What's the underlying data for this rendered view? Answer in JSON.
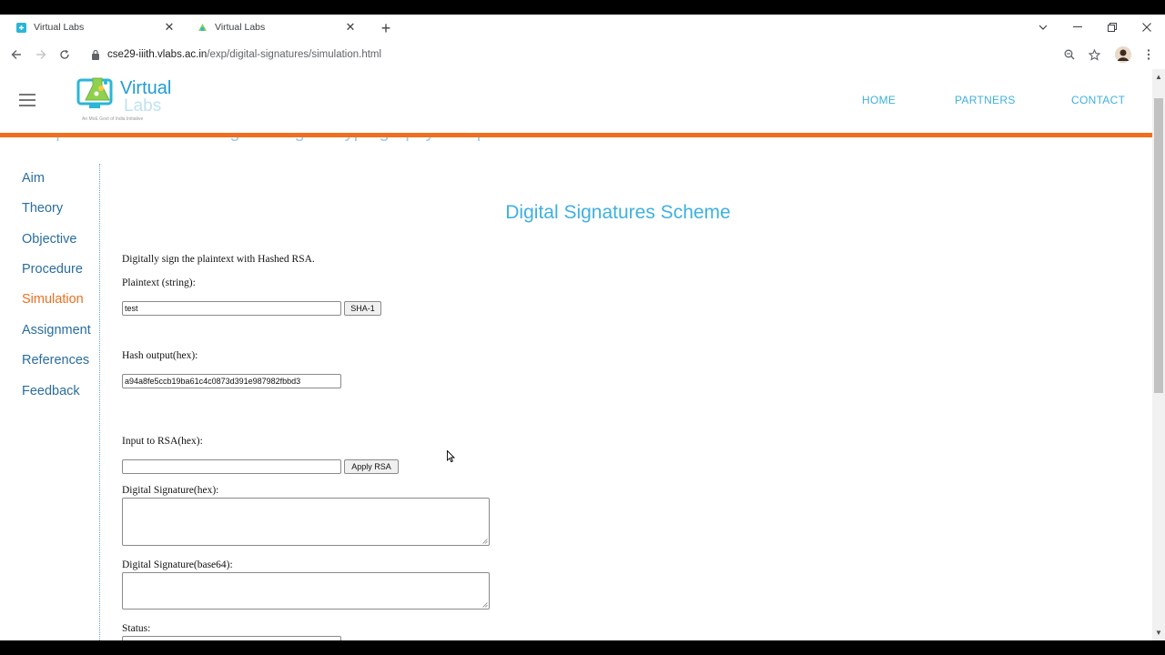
{
  "browser": {
    "tabs": [
      {
        "title": "Virtual Labs"
      },
      {
        "title": "Virtual Labs"
      }
    ],
    "url_domain": "cse29-iiith.vlabs.ac.in",
    "url_path": "/exp/digital-signatures/simulation.html"
  },
  "site": {
    "logo_text_1": "Virtual",
    "logo_text_2": "Labs",
    "logo_tagline": "An MoE Govt of India Initiative",
    "nav": {
      "home": "HOME",
      "partners": "PARTNERS",
      "contact": "CONTACT"
    },
    "breadcrumb": "Computer Science and Engineering > Cryptography > Experiments",
    "accent_color": "#ef6f1f",
    "link_color": "#3fb0e0"
  },
  "sidebar": {
    "items": [
      {
        "label": "Aim"
      },
      {
        "label": "Theory"
      },
      {
        "label": "Objective"
      },
      {
        "label": "Procedure"
      },
      {
        "label": "Simulation",
        "active": true
      },
      {
        "label": "Assignment"
      },
      {
        "label": "References"
      },
      {
        "label": "Feedback"
      }
    ]
  },
  "main": {
    "title": "Digital Signatures Scheme",
    "intro": "Digitally sign the plaintext with Hashed RSA.",
    "plaintext_label": "Plaintext (string):",
    "plaintext_value": "test",
    "sha_button": "SHA-1",
    "hash_label": "Hash output(hex):",
    "hash_value": "a94a8fe5ccb19ba61c4c0873d391e987982fbbd3",
    "rsa_input_label": "Input to RSA(hex):",
    "rsa_input_value": "",
    "apply_rsa_button": "Apply RSA",
    "sig_hex_label": "Digital Signature(hex):",
    "sig_b64_label": "Digital Signature(base64):",
    "status_label": "Status:"
  }
}
